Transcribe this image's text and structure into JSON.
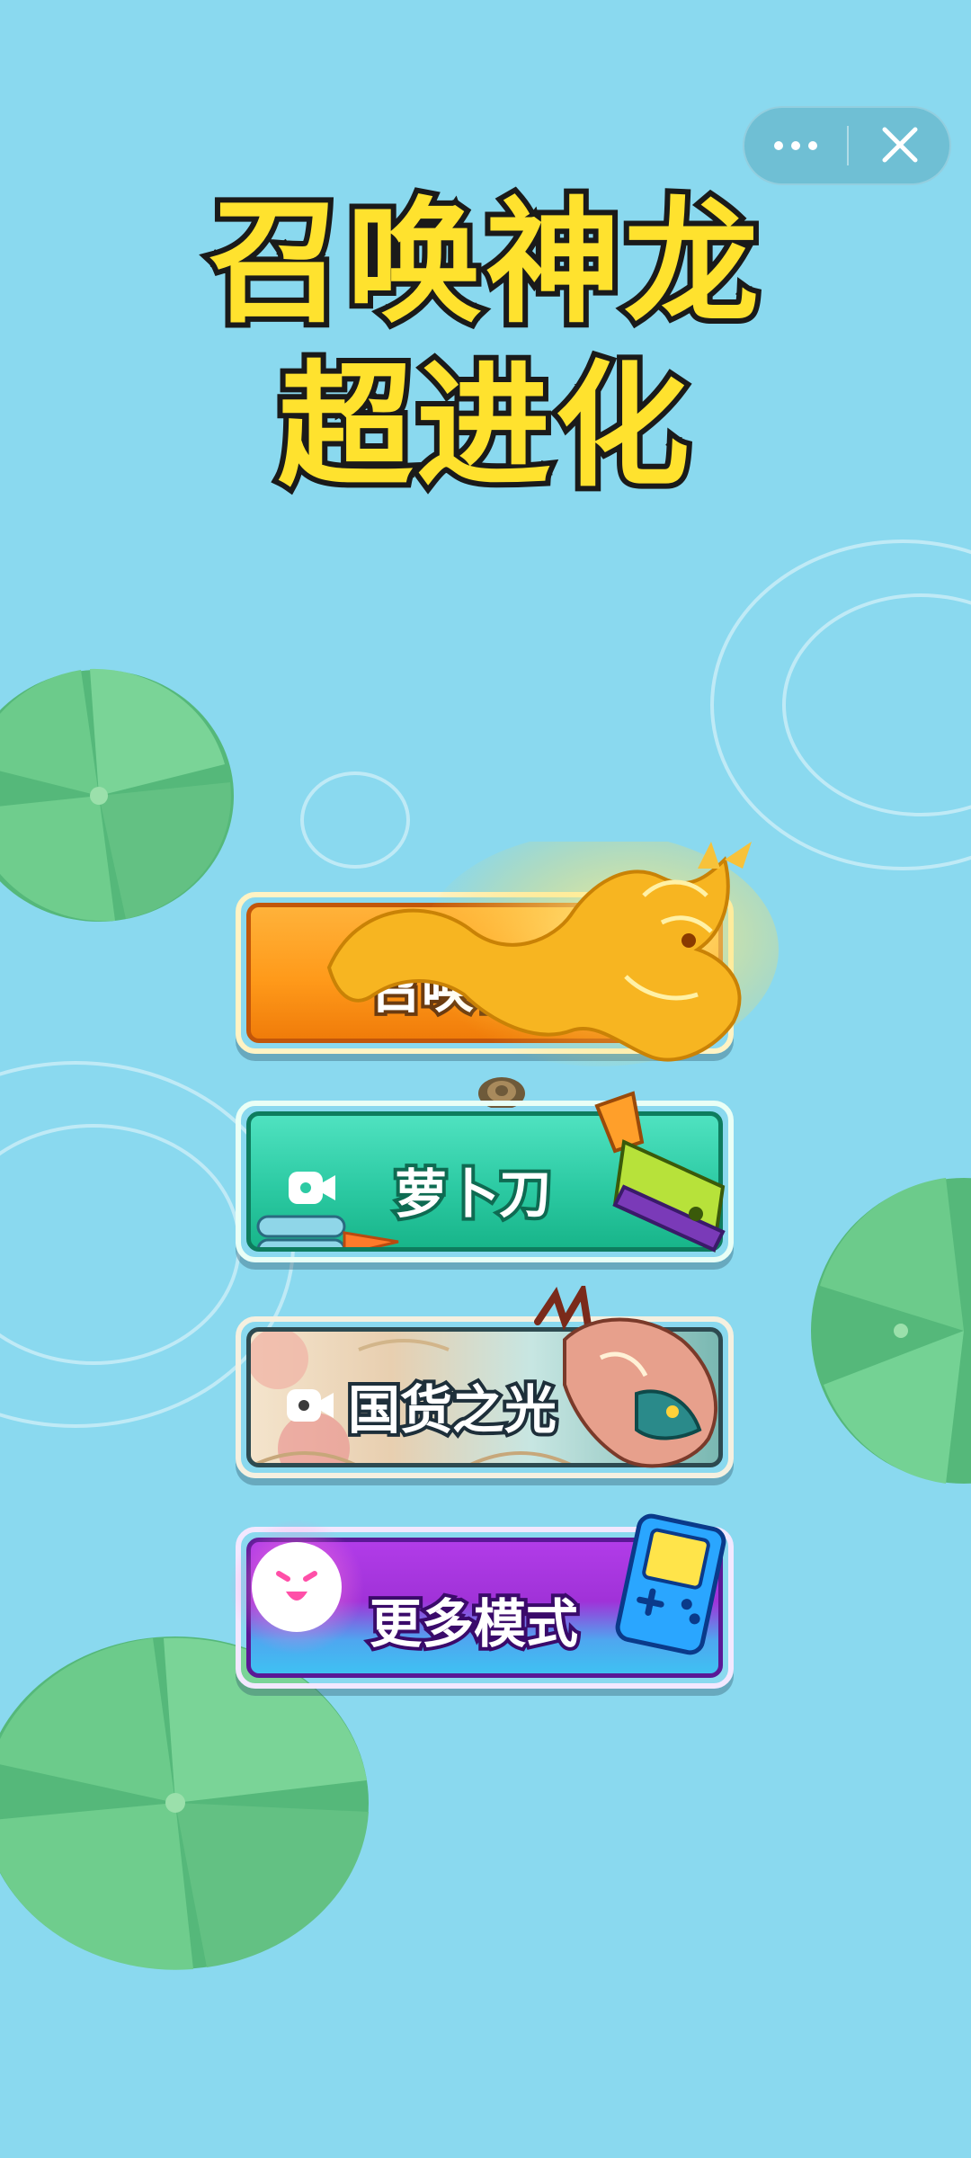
{
  "capsule": {
    "more_icon": "more-dots-icon",
    "close_icon": "close-icon"
  },
  "title": {
    "line1": "召唤神龙",
    "line2": "超进化"
  },
  "menu": {
    "buttons": [
      {
        "label": "召唤神龙",
        "icon": "golden-dragon-icon",
        "video": false
      },
      {
        "label": "萝卜刀",
        "icon": "carrot-knife-icon",
        "video": true
      },
      {
        "label": "国货之光",
        "icon": "chinese-dragon-icon",
        "video": true
      },
      {
        "label": "更多模式",
        "icon": "game-console-icon",
        "video": false
      }
    ]
  },
  "colors": {
    "background": "#8ad9ef",
    "title_fill": "#ffe22e",
    "lily_pad": "#6cc98a"
  }
}
